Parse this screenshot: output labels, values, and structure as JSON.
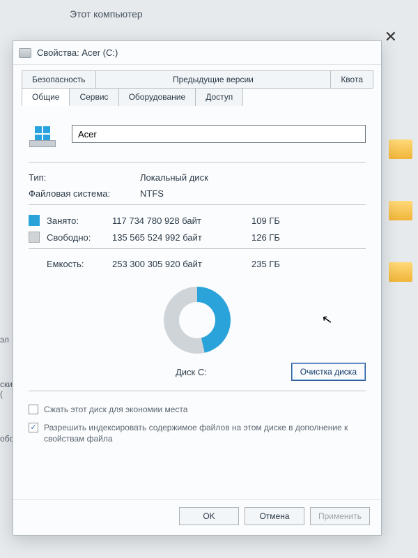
{
  "background": {
    "explorer_title": "Этот компьютер",
    "left_label_1": "эл",
    "left_label_2": "ски (",
    "left_label_3": "ободно"
  },
  "dialog": {
    "title": "Свойства: Acer (C:)",
    "tabs": {
      "row1": [
        "Безопасность",
        "Предыдущие версии",
        "Квота"
      ],
      "row2": [
        "Общие",
        "Сервис",
        "Оборудование",
        "Доступ"
      ],
      "active": "Общие"
    },
    "volume_name": "Acer",
    "type_label": "Тип:",
    "type_value": "Локальный диск",
    "fs_label": "Файловая система:",
    "fs_value": "NTFS",
    "used_label": "Занято:",
    "used_bytes": "117 734 780 928 байт",
    "used_gb": "109 ГБ",
    "free_label": "Свободно:",
    "free_bytes": "135 565 524 992 байт",
    "free_gb": "126 ГБ",
    "capacity_label": "Емкость:",
    "capacity_bytes": "253 300 305 920 байт",
    "capacity_gb": "235 ГБ",
    "disk_label": "Диск C:",
    "cleanup_button": "Очистка диска",
    "check_compress": "Сжать этот диск для экономии места",
    "check_index": "Разрешить индексировать содержимое файлов на этом диске в дополнение к свойствам файла",
    "buttons": {
      "ok": "OK",
      "cancel": "Отмена",
      "apply": "Применить"
    }
  },
  "chart_data": {
    "type": "pie",
    "title": "Диск C:",
    "series": [
      {
        "name": "Занято",
        "value": 117734780928,
        "display": "109 ГБ",
        "color": "#29a3d9"
      },
      {
        "name": "Свободно",
        "value": 135565524992,
        "display": "126 ГБ",
        "color": "#cfd4d8"
      }
    ],
    "total": {
      "name": "Емкость",
      "value": 253300305920,
      "display": "235 ГБ"
    }
  }
}
